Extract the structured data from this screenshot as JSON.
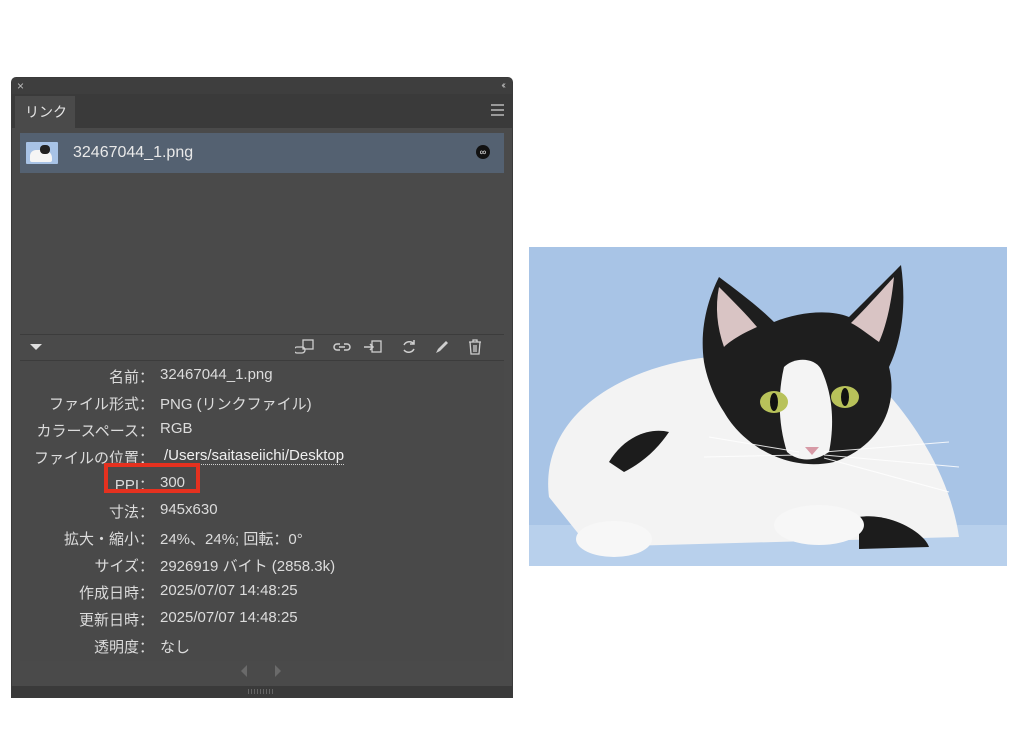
{
  "panel": {
    "close_glyph": "×",
    "collapse_glyph": "‹‹",
    "tab_label": "リンク",
    "menu_icon": "hamburger-menu-icon",
    "file_item": {
      "name": "32467044_1.png",
      "badge_icon": "link-badge-icon",
      "badge_glyph": "∞"
    },
    "toolbar_icons": [
      "relink-from-libraries-icon",
      "relink-icon",
      "goto-link-icon",
      "update-link-icon",
      "edit-original-icon",
      "delete-icon"
    ],
    "info_rows": [
      {
        "label": "名前：",
        "value": "32467044_1.png"
      },
      {
        "label": "ファイル形式：",
        "value": "PNG (リンクファイル)"
      },
      {
        "label": "カラースペース：",
        "value": "RGB"
      },
      {
        "label": "ファイルの位置：",
        "value": "/Users/saitaseiichi/Desktop"
      },
      {
        "label": "PPI：",
        "value": "300"
      },
      {
        "label": "寸法：",
        "value": "945x630"
      },
      {
        "label": "拡大・縮小：",
        "value": "24%、24%; 回転：0°"
      },
      {
        "label": "サイズ：",
        "value": "2926919 バイト (2858.3k)"
      },
      {
        "label": "作成日時：",
        "value": "2025/07/07 14:48:25"
      },
      {
        "label": "更新日時：",
        "value": "2025/07/07 14:48:25"
      },
      {
        "label": "透明度：",
        "value": "なし"
      }
    ],
    "highlight_color": "#e5311f"
  },
  "photo": {
    "subject": "black-and-white cat on light blue background"
  }
}
